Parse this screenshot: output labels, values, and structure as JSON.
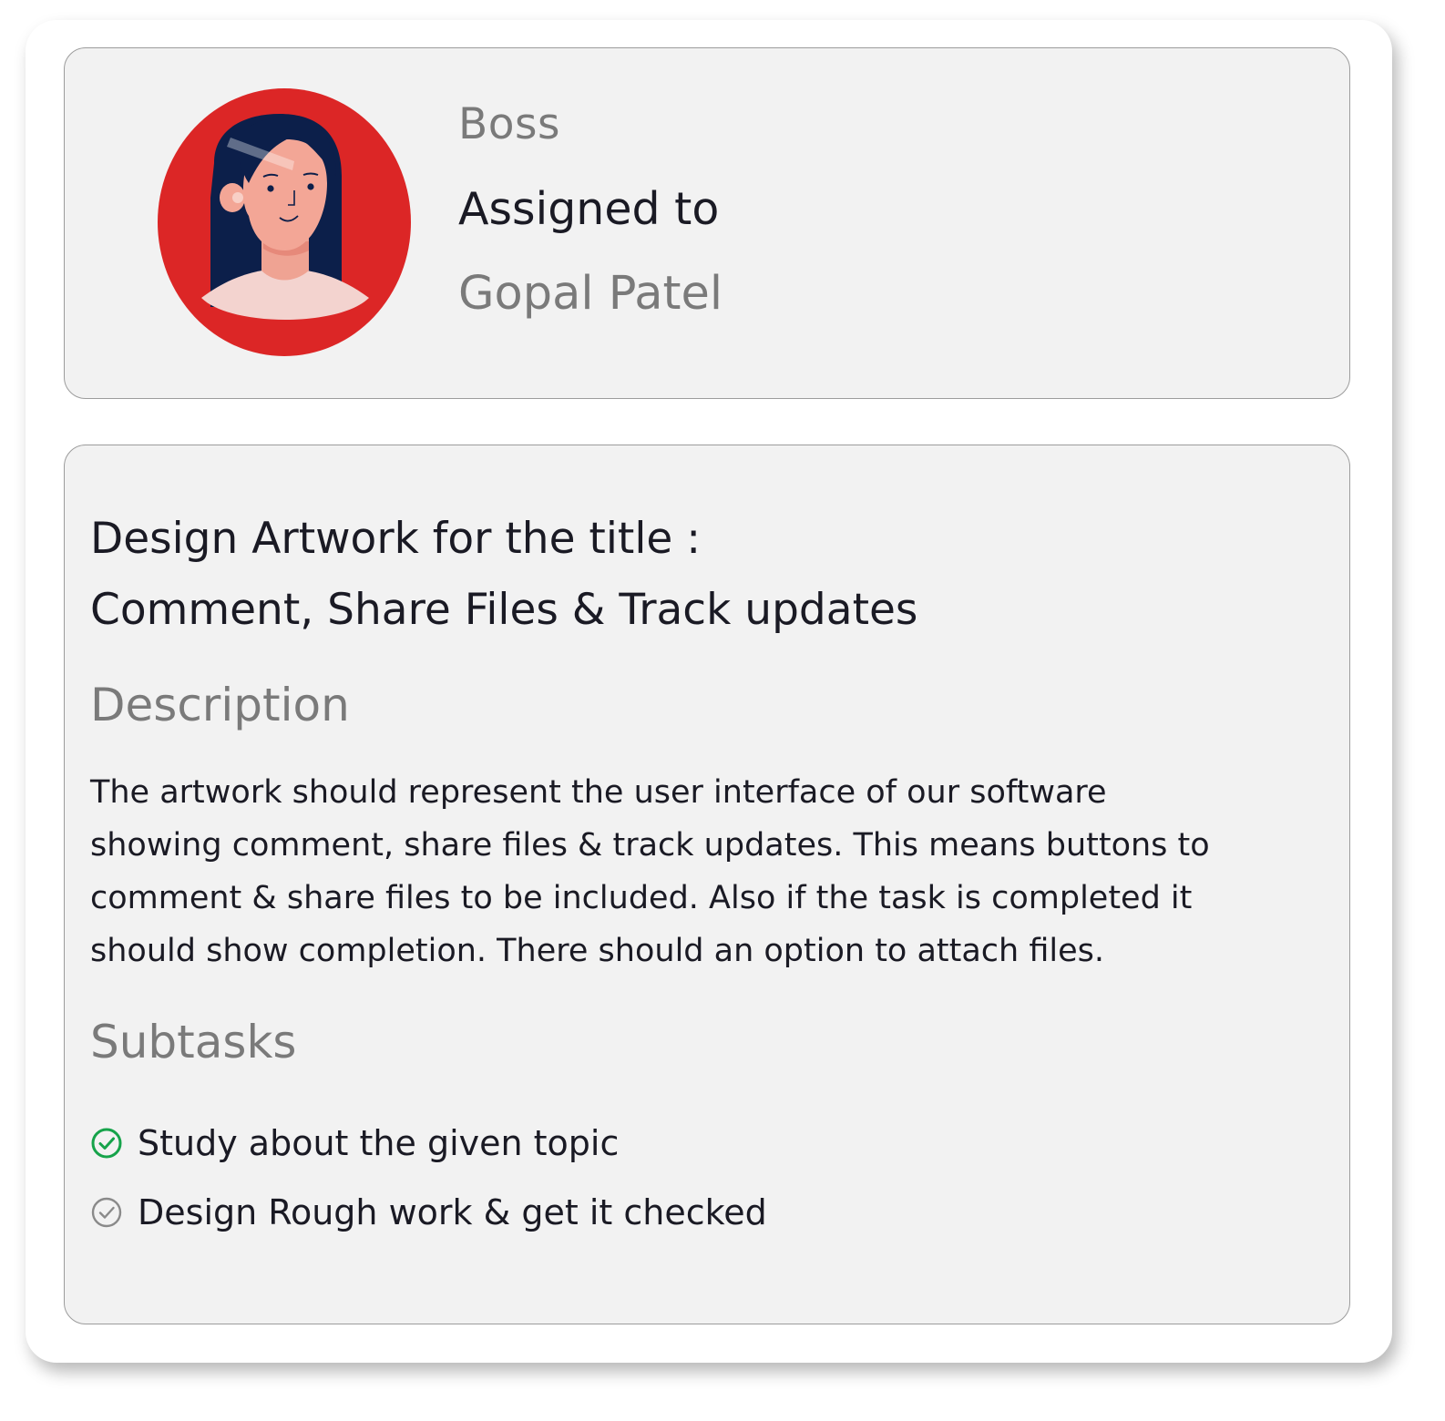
{
  "assignment": {
    "role_label": "Boss",
    "assigned_label": "Assigned to",
    "assignee_name": "Gopal Patel",
    "avatar": "woman-avatar-red-circle"
  },
  "task": {
    "title_lines": [
      "Design Artwork for the title :",
      "Comment, Share Files & Track updates"
    ],
    "description_heading": "Description",
    "description_lines": [
      "The artwork should represent the user interface of our software",
      "showing comment, share files & track updates. This means buttons to",
      "comment & share files to be included. Also if the task is completed it",
      "should show completion. There should an option to attach files."
    ],
    "subtasks_heading": "Subtasks",
    "subtasks": [
      {
        "label": "Study about the given topic",
        "status": "completed",
        "icon": "check-circle-icon"
      },
      {
        "label": "Design Rough work & get it checked",
        "status": "pending",
        "icon": "check-circle-icon"
      }
    ]
  },
  "colors": {
    "avatar_bg": "#dc2626",
    "completed": "#16a34a",
    "pending": "#8a8a8a",
    "muted_text": "#7a7a7a",
    "text": "#1a1a24"
  }
}
